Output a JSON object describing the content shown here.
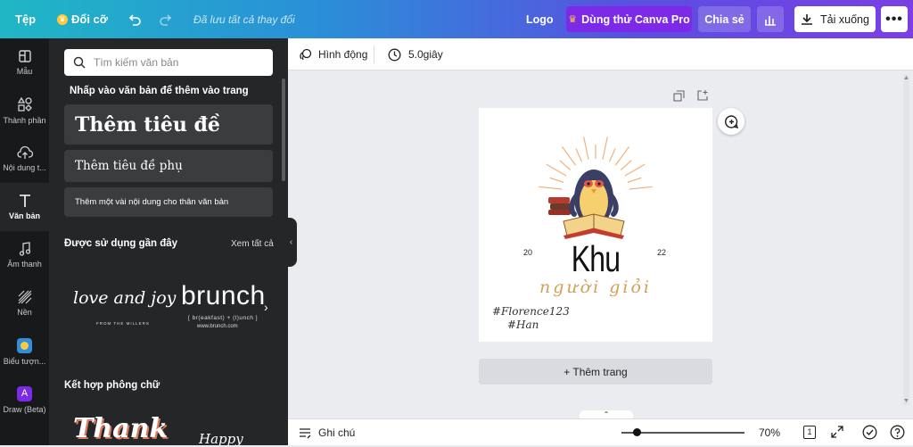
{
  "topbar": {
    "file_label": "Tệp",
    "resize_label": "Đổi cỡ",
    "save_status": "Đã lưu tất cả thay đổi",
    "logo_label": "Logo",
    "try_pro_label": "Dùng thử Canva Pro",
    "share_label": "Chia sẻ",
    "download_label": "Tải xuống"
  },
  "rail": {
    "items": [
      {
        "label": "Mẫu",
        "icon": "template-icon"
      },
      {
        "label": "Thành phần",
        "icon": "elements-icon"
      },
      {
        "label": "Nội dung t...",
        "icon": "upload-icon"
      },
      {
        "label": "Văn bản",
        "icon": "text-icon"
      },
      {
        "label": "Âm thanh",
        "icon": "music-icon"
      },
      {
        "label": "Nền",
        "icon": "background-icon"
      },
      {
        "label": "Biểu tượn...",
        "icon": "emoji-icon"
      },
      {
        "label": "Draw (Beta)",
        "icon": "draw-icon"
      }
    ]
  },
  "panel": {
    "search_placeholder": "Tìm kiếm văn bản",
    "instruction": "Nhấp vào văn bản để thêm vào trang",
    "heading_label": "Thêm tiêu đề",
    "subheading_label": "Thêm tiêu đề phụ",
    "body_label": "Thêm một vài nội dung cho thân văn bản",
    "recent_title": "Được sử dụng gần đây",
    "see_all": "Xem tất cả",
    "recent_items": [
      {
        "main": "love and joy",
        "sub": "FROM THE MILLERS"
      },
      {
        "main": "brunch",
        "sub": "[ br(eakfast) + (l)unch ]",
        "sub2": "www.brunch.com"
      }
    ],
    "combos_title": "Kết hợp phông chữ",
    "combo_items": [
      "Thank",
      "Happy"
    ]
  },
  "editor": {
    "animate_label": "Hình động",
    "duration_label": "5.0giây",
    "add_page_label": "+ Thêm trang",
    "notes_label": "Ghi chú",
    "zoom": "70%",
    "page_number": "1"
  },
  "design": {
    "title": "Khu",
    "subtitle": "người giỏi",
    "year_left": "20",
    "year_right": "22",
    "sign1": "#Florence123",
    "sign2": "#Han"
  },
  "colors": {
    "accent_pro": "#7d2ae8",
    "sunburst": "#f0b27a",
    "subtitle": "#d4a055"
  }
}
